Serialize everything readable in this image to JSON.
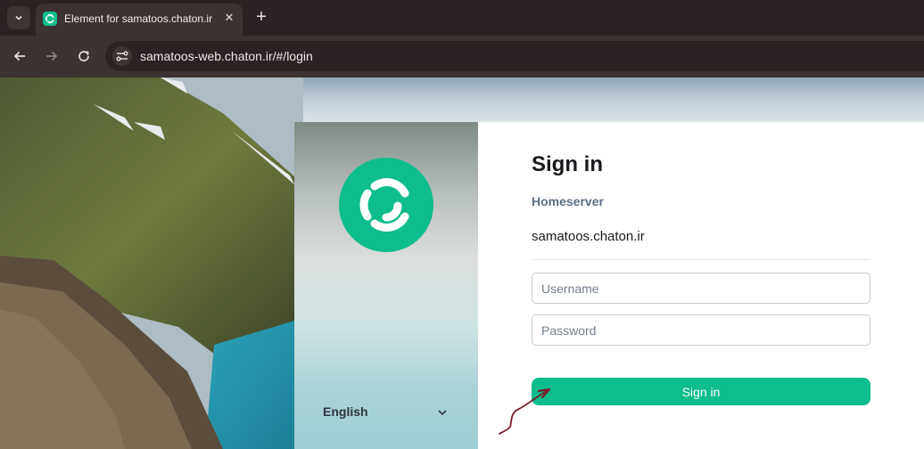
{
  "browser": {
    "tab": {
      "title": "Element for samatoos.chaton.ir"
    },
    "url": "samatoos-web.chaton.ir/#/login"
  },
  "brand": {
    "logo_icon": "element-logo-icon",
    "language": "English"
  },
  "login": {
    "title": "Sign in",
    "homeserver_label": "Homeserver",
    "homeserver_value": "samatoos.chaton.ir",
    "username_placeholder": "Username",
    "password_placeholder": "Password",
    "submit_label": "Sign in"
  },
  "colors": {
    "accent": "#0dbd8b",
    "annotation_arrow": "#7a1a2a"
  }
}
